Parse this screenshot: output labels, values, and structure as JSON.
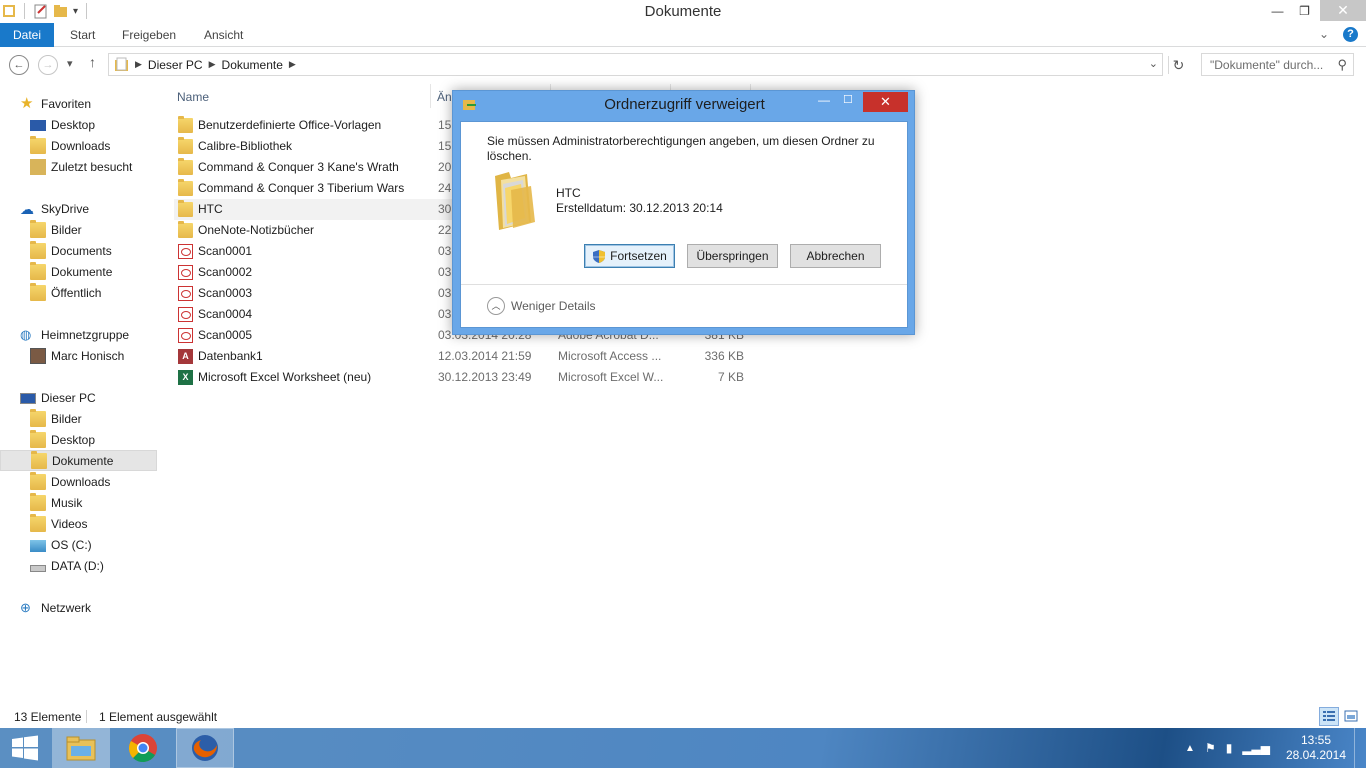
{
  "window": {
    "title": "Dokumente",
    "min_label": "—",
    "restore_label": "❐",
    "close_label": "✕"
  },
  "ribbon": {
    "tabs": [
      "Datei",
      "Start",
      "Freigeben",
      "Ansicht"
    ]
  },
  "address": {
    "crumbs": [
      "Dieser PC",
      "Dokumente"
    ],
    "search_placeholder": "\"Dokumente\" durch..."
  },
  "navpane": {
    "favorites": {
      "label": "Favoriten",
      "items": [
        "Desktop",
        "Downloads",
        "Zuletzt besucht"
      ]
    },
    "skydrive": {
      "label": "SkyDrive",
      "items": [
        "Bilder",
        "Documents",
        "Dokumente",
        "Öffentlich"
      ]
    },
    "homegroup": {
      "label": "Heimnetzgruppe",
      "items": [
        "Marc Honisch"
      ]
    },
    "thispc": {
      "label": "Dieser PC",
      "items": [
        "Bilder",
        "Desktop",
        "Dokumente",
        "Downloads",
        "Musik",
        "Videos",
        "OS (C:)",
        "DATA (D:)"
      ]
    },
    "network": {
      "label": "Netzwerk"
    }
  },
  "columns": {
    "name": "Name",
    "date_partial": "Än"
  },
  "files": [
    {
      "name": "Benutzerdefinierte Office-Vorlagen",
      "date": "15.",
      "type": "",
      "size": "",
      "kind": "folder"
    },
    {
      "name": "Calibre-Bibliothek",
      "date": "15.",
      "type": "",
      "size": "",
      "kind": "folder"
    },
    {
      "name": "Command & Conquer 3 Kane's Wrath",
      "date": "20.",
      "type": "",
      "size": "",
      "kind": "folder"
    },
    {
      "name": "Command & Conquer 3 Tiberium Wars",
      "date": "24.",
      "type": "",
      "size": "",
      "kind": "folder"
    },
    {
      "name": "HTC",
      "date": "30.",
      "type": "",
      "size": "",
      "kind": "folder"
    },
    {
      "name": "OneNote-Notizbücher",
      "date": "22.",
      "type": "",
      "size": "",
      "kind": "folder"
    },
    {
      "name": "Scan0001",
      "date": "03.",
      "type": "",
      "size": "",
      "kind": "pdf"
    },
    {
      "name": "Scan0002",
      "date": "03.",
      "type": "",
      "size": "",
      "kind": "pdf"
    },
    {
      "name": "Scan0003",
      "date": "03.",
      "type": "",
      "size": "",
      "kind": "pdf"
    },
    {
      "name": "Scan0004",
      "date": "03.",
      "type": "",
      "size": "",
      "kind": "pdf"
    },
    {
      "name": "Scan0005",
      "date": "03.03.2014 20:28",
      "type": "Adobe Acrobat D...",
      "size": "381 KB",
      "kind": "pdf"
    },
    {
      "name": "Datenbank1",
      "date": "12.03.2014 21:59",
      "type": "Microsoft Access ...",
      "size": "336 KB",
      "kind": "access"
    },
    {
      "name": "Microsoft Excel Worksheet (neu)",
      "date": "30.12.2013 23:49",
      "type": "Microsoft Excel W...",
      "size": "7 KB",
      "kind": "excel"
    }
  ],
  "status": {
    "count": "13 Elemente",
    "selected": "1 Element ausgewählt"
  },
  "dialog": {
    "title": "Ordnerzugriff verweigert",
    "message": "Sie müssen Administratorberechtigungen angeben, um diesen Ordner zu löschen.",
    "folder_name": "HTC",
    "created": "Erstelldatum: 30.12.2013 20:14",
    "continue_label": "Fortsetzen",
    "skip_label": "Überspringen",
    "cancel_label": "Abbrechen",
    "less_details": "Weniger Details"
  },
  "taskbar": {
    "time": "13:55",
    "date": "28.04.2014"
  },
  "colors": {
    "accent": "#1979ca",
    "dialog_frame": "#69a7e8",
    "close_red": "#c7312b"
  }
}
